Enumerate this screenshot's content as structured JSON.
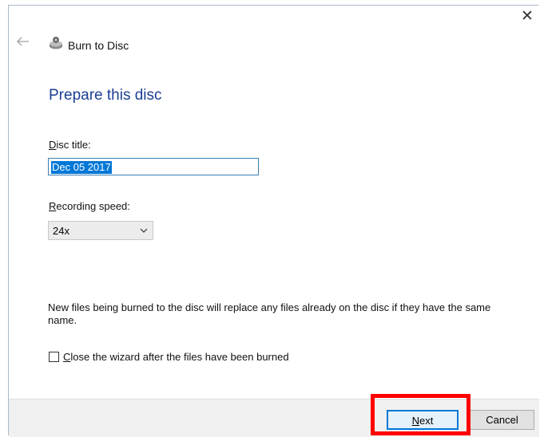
{
  "header": {
    "back_icon": "arrow-left-icon",
    "wizard_icon": "burn-disc-icon",
    "title": "Burn to Disc",
    "close_label": "✕"
  },
  "main": {
    "heading": "Prepare this disc",
    "disc_title": {
      "label_mnemonic": "D",
      "label_rest": "isc title:",
      "value": "Dec 05 2017"
    },
    "recording_speed": {
      "label_mnemonic": "R",
      "label_rest": "ecording speed:",
      "selected": "24x"
    },
    "info": "New files being burned to the disc will replace any files already on the disc if they have the same name.",
    "close_wizard": {
      "checked": false,
      "label_mnemonic": "C",
      "label_rest": "lose the wizard after the files have been burned"
    }
  },
  "footer": {
    "next_mnemonic": "N",
    "next_rest": "ext",
    "cancel_label": "Cancel"
  },
  "colors": {
    "heading": "#1c3f94",
    "selection": "#0078d7",
    "highlight": "#ff0000"
  }
}
